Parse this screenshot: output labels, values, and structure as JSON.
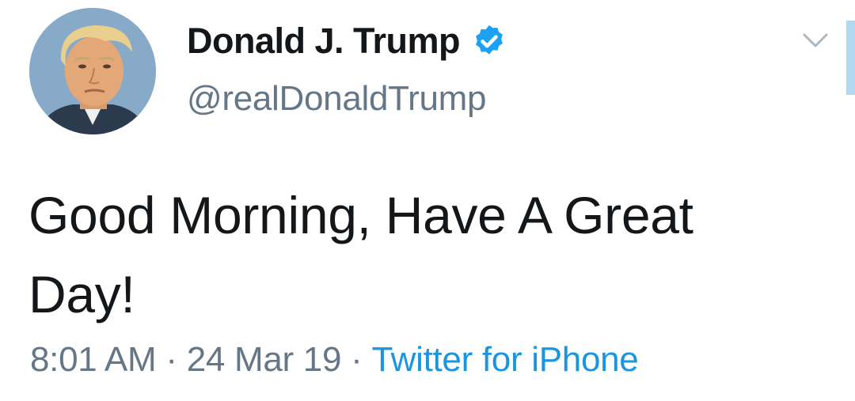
{
  "tweet": {
    "author": {
      "display_name": "Donald J. Trump",
      "handle": "@realDonaldTrump",
      "verified": true,
      "avatar_icon": "profile-photo"
    },
    "text": "Good Morning, Have A Great Day!",
    "time": "8:01 AM",
    "separator": "·",
    "date": "24 Mar 19",
    "source": "Twitter for iPhone",
    "menu_icon": "chevron-down-icon"
  },
  "colors": {
    "primary_text": "#14171a",
    "secondary_text": "#657786",
    "link_blue": "#1b95e0",
    "verified_blue": "#1da1f2",
    "scroll_indicator": "#b3d9f2"
  }
}
